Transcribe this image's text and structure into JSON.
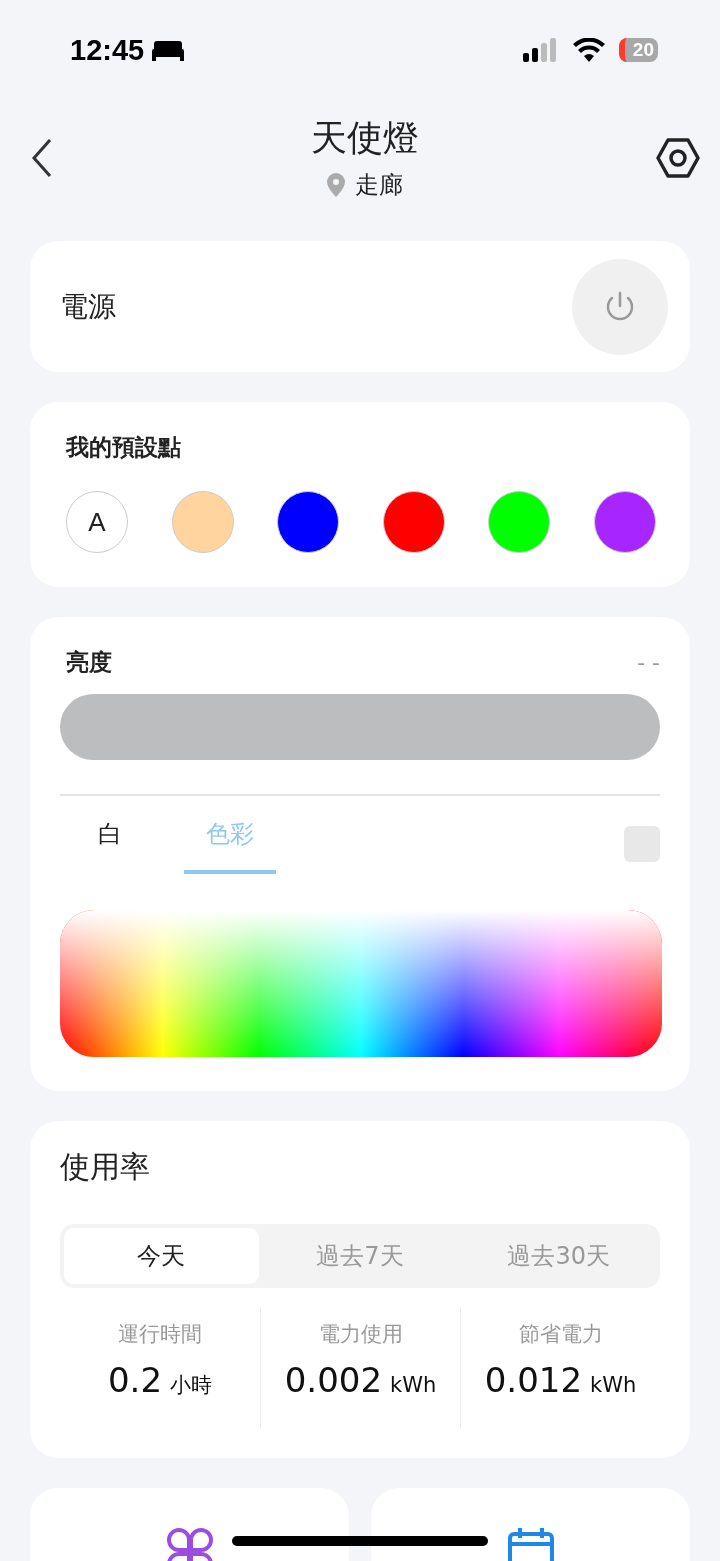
{
  "status_bar": {
    "time": "12:45",
    "battery": "20"
  },
  "header": {
    "title": "天使燈",
    "location": "走廊"
  },
  "power": {
    "label": "電源",
    "on": false
  },
  "presets": {
    "title": "我的預設點",
    "items": [
      {
        "kind": "auto",
        "label": "A"
      },
      {
        "kind": "color",
        "color": "#ffd49f"
      },
      {
        "kind": "color",
        "color": "#0000ff"
      },
      {
        "kind": "color",
        "color": "#ff0000"
      },
      {
        "kind": "color",
        "color": "#00ff00"
      },
      {
        "kind": "color",
        "color": "#a726ff"
      }
    ]
  },
  "brightness": {
    "title": "亮度",
    "reading": "- -",
    "disabled": true
  },
  "mode_tabs": [
    {
      "label": "白",
      "selected": false
    },
    {
      "label": "色彩",
      "selected": true
    }
  ],
  "usage": {
    "title": "使用率",
    "tabs": [
      {
        "label": "今天",
        "selected": true
      },
      {
        "label": "過去7天",
        "selected": false
      },
      {
        "label": "過去30天",
        "selected": false
      }
    ],
    "stats": [
      {
        "label": "運行時間",
        "value": "0.2",
        "unit": "小時"
      },
      {
        "label": "電力使用",
        "value": "0.002",
        "unit": "kWh"
      },
      {
        "label": "節省電力",
        "value": "0.012",
        "unit": "kWh"
      }
    ]
  }
}
